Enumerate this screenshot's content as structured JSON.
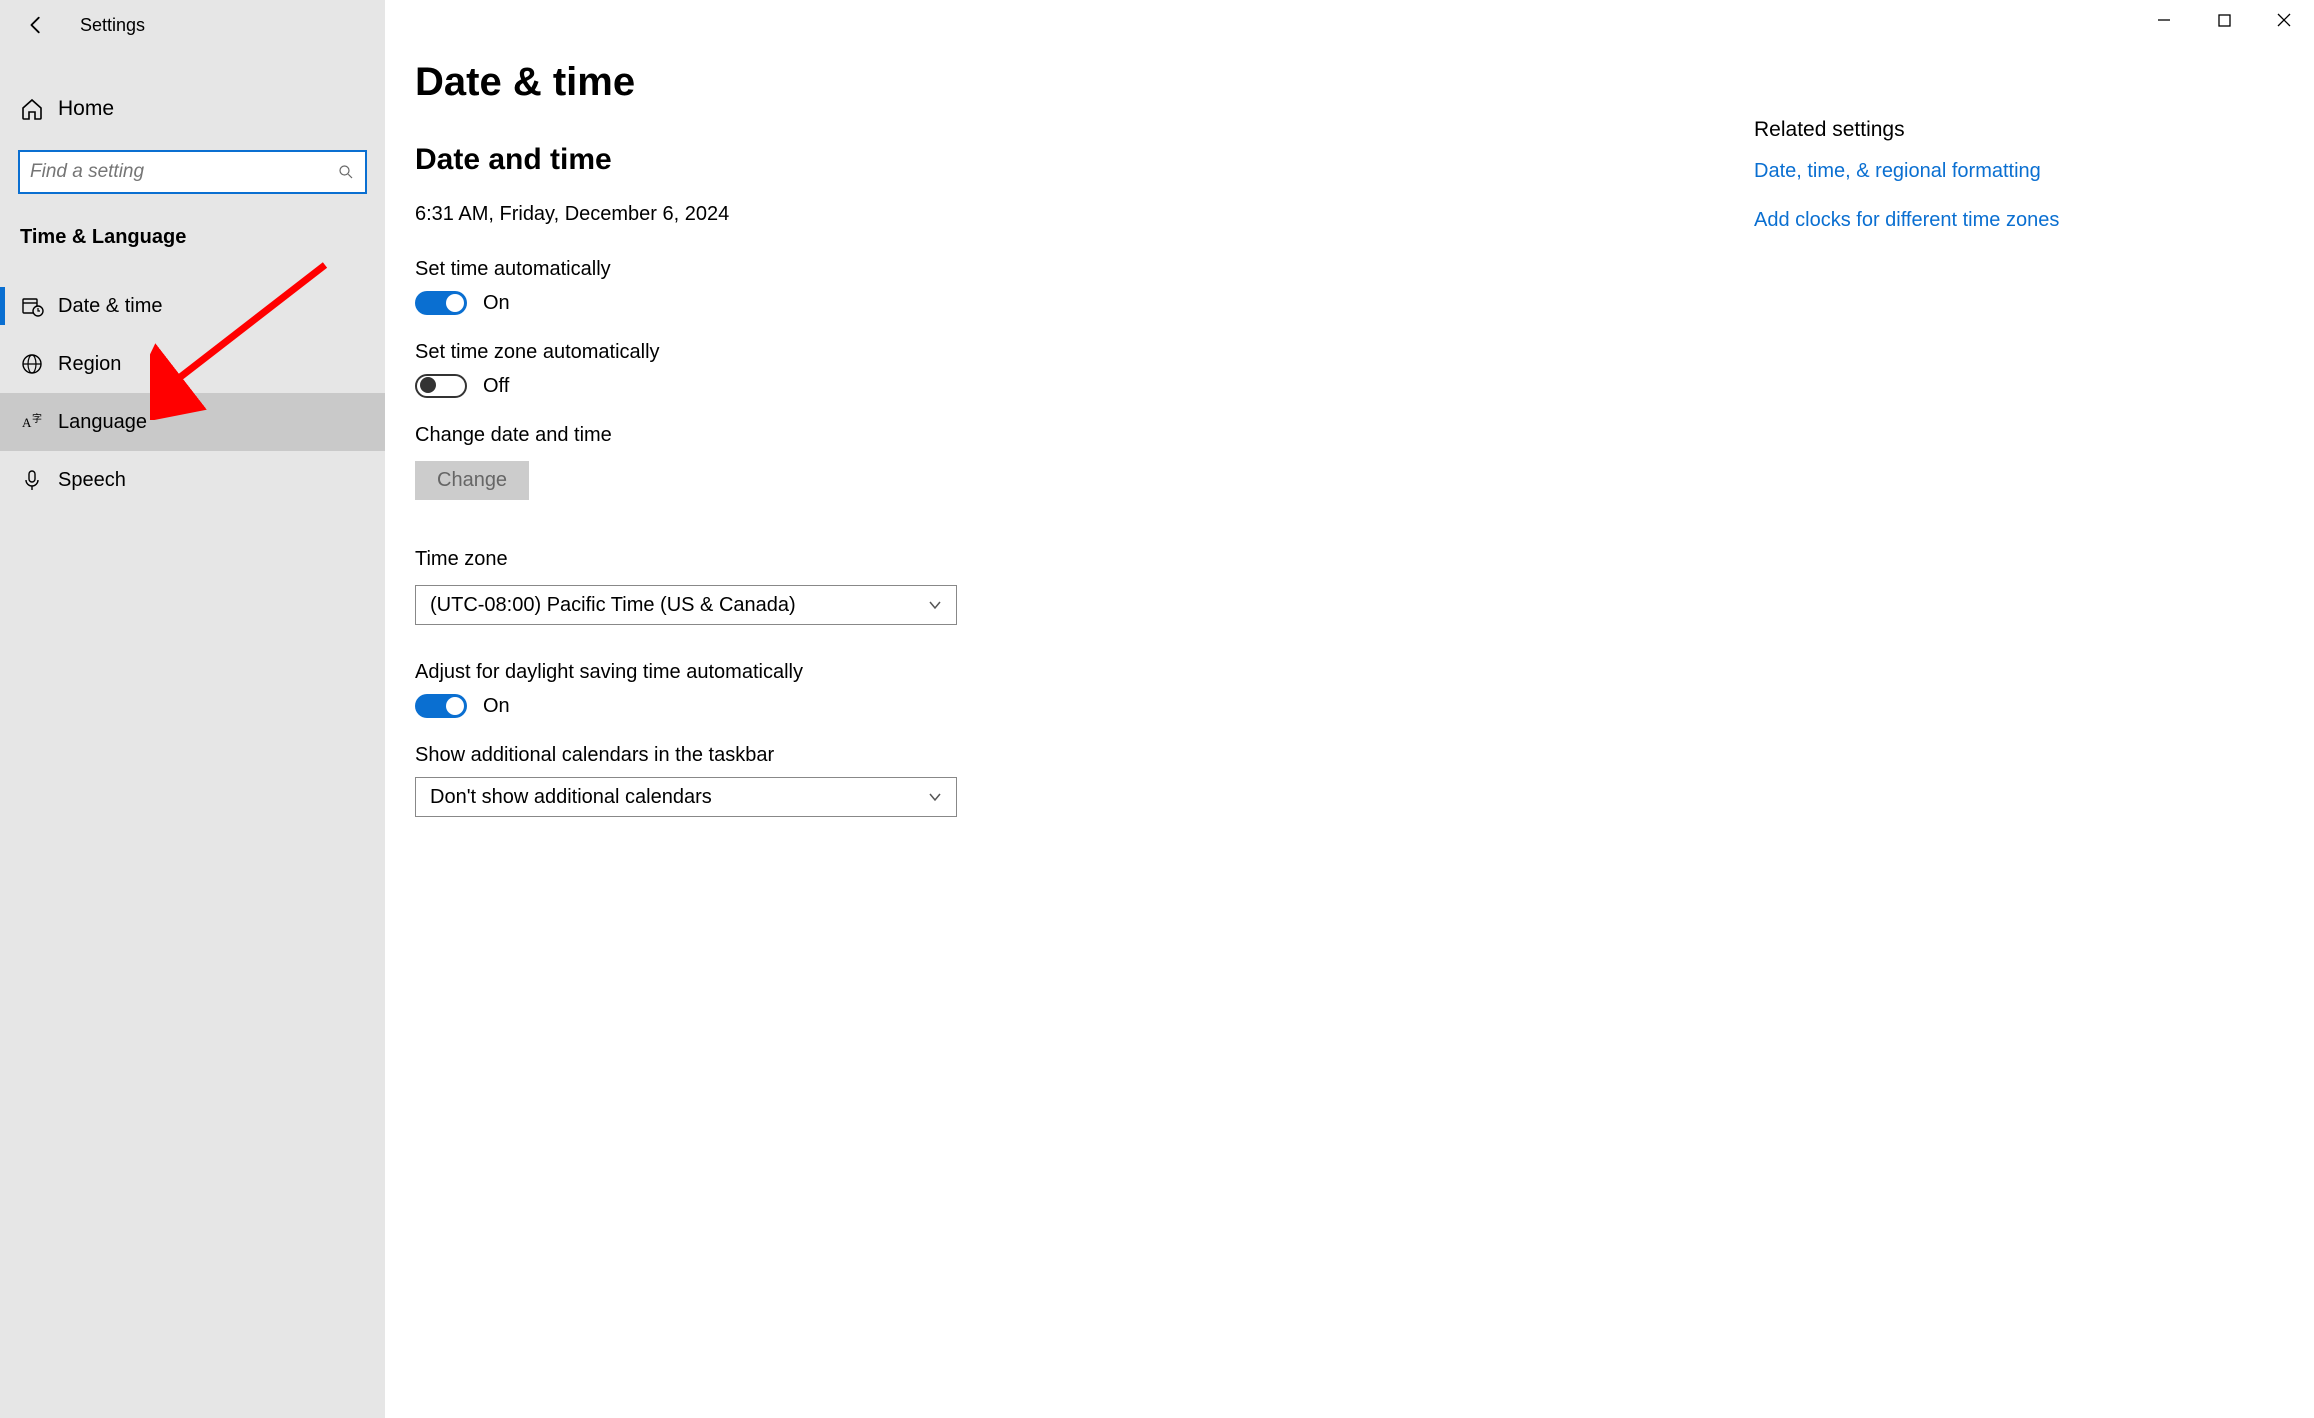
{
  "window": {
    "title": "Settings"
  },
  "sidebar": {
    "home": "Home",
    "search_placeholder": "Find a setting",
    "category": "Time & Language",
    "items": [
      {
        "id": "date-time",
        "label": "Date & time",
        "active": true
      },
      {
        "id": "region",
        "label": "Region"
      },
      {
        "id": "language",
        "label": "Language",
        "hover": true
      },
      {
        "id": "speech",
        "label": "Speech"
      }
    ]
  },
  "page": {
    "title": "Date & time",
    "section_title": "Date and time",
    "current_time": "6:31 AM, Friday, December 6, 2024",
    "set_time_auto": {
      "label": "Set time automatically",
      "state": "On"
    },
    "set_tz_auto": {
      "label": "Set time zone automatically",
      "state": "Off"
    },
    "change_dt": {
      "label": "Change date and time",
      "button": "Change"
    },
    "timezone": {
      "label": "Time zone",
      "value": "(UTC-08:00) Pacific Time (US & Canada)"
    },
    "dst": {
      "label": "Adjust for daylight saving time automatically",
      "state": "On"
    },
    "add_cal": {
      "label": "Show additional calendars in the taskbar",
      "value": "Don't show additional calendars"
    }
  },
  "rail": {
    "title": "Related settings",
    "links": [
      "Date, time, & regional formatting",
      "Add clocks for different time zones"
    ]
  }
}
